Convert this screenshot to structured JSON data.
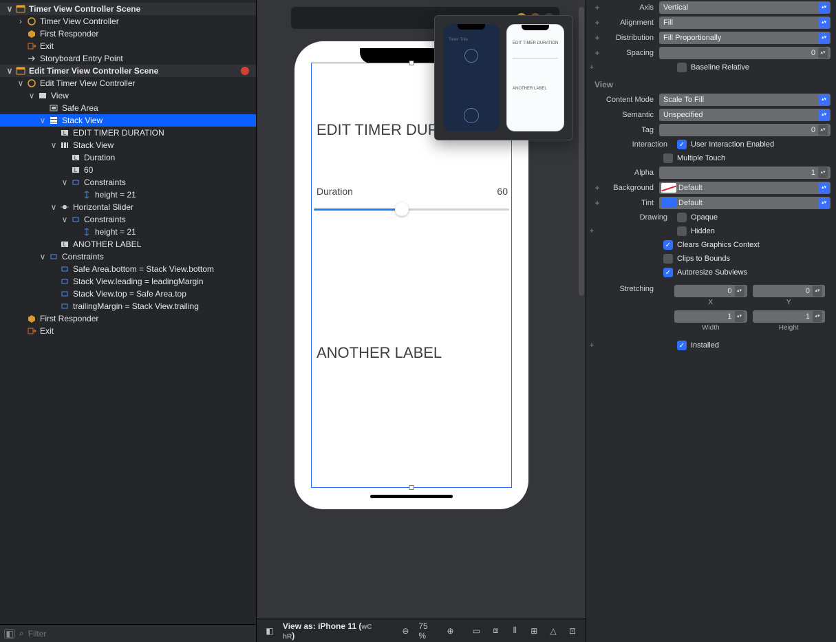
{
  "outline": {
    "scene1": "Timer View Controller Scene",
    "scene1_vc": "Timer View Controller",
    "first_responder": "First Responder",
    "exit": "Exit",
    "sb_entry": "Storyboard Entry Point",
    "scene2": "Edit Timer View Controller Scene",
    "scene2_vc": "Edit Timer View Controller",
    "view": "View",
    "safe_area": "Safe Area",
    "stack_view": "Stack View",
    "edit_timer_label": "EDIT TIMER DURATION",
    "stack_view_inner": "Stack View",
    "duration": "Duration",
    "sixty": "60",
    "constraints": "Constraints",
    "height21_a": "height = 21",
    "h_slider": "Horizontal Slider",
    "height21_b": "height = 21",
    "another_label": "ANOTHER LABEL",
    "c1": "Safe Area.bottom = Stack View.bottom",
    "c2": "Stack View.leading = leadingMargin",
    "c3": "Stack View.top = Safe Area.top",
    "c4": "trailingMargin = Stack View.trailing",
    "filter_placeholder": "Filter"
  },
  "canvas": {
    "edit_title": "EDIT TIMER DURATION",
    "duration_label": "Duration",
    "duration_value": "60",
    "another": "ANOTHER LABEL"
  },
  "minimap": {
    "a_title": "Timer Title",
    "b_title": "EDIT TIMER DURATION",
    "b_another": "ANOTHER LABEL"
  },
  "devicebar": {
    "view_as_prefix": "View as: iPhone 11 (",
    "wc": "wC",
    "hr": "hR",
    "view_as_suffix": ")",
    "zoom": "75 %"
  },
  "inspector": {
    "axis_label": "Axis",
    "axis_value": "Vertical",
    "alignment_label": "Alignment",
    "alignment_value": "Fill",
    "distribution_label": "Distribution",
    "distribution_value": "Fill Proportionally",
    "spacing_label": "Spacing",
    "spacing_value": "0",
    "baseline_relative": "Baseline Relative",
    "section_view": "View",
    "content_mode_label": "Content Mode",
    "content_mode_value": "Scale To Fill",
    "semantic_label": "Semantic",
    "semantic_value": "Unspecified",
    "tag_label": "Tag",
    "tag_value": "0",
    "interaction_label": "Interaction",
    "user_interaction": "User Interaction Enabled",
    "multiple_touch": "Multiple Touch",
    "alpha_label": "Alpha",
    "alpha_value": "1",
    "background_label": "Background",
    "background_value": "Default",
    "tint_label": "Tint",
    "tint_value": "Default",
    "drawing_label": "Drawing",
    "opaque": "Opaque",
    "hidden": "Hidden",
    "clears_gc": "Clears Graphics Context",
    "clips": "Clips to Bounds",
    "autoresize": "Autoresize Subviews",
    "stretching_label": "Stretching",
    "stretch_x": "0",
    "stretch_y": "0",
    "stretch_w": "1",
    "stretch_h": "1",
    "sub_x": "X",
    "sub_y": "Y",
    "sub_w": "Width",
    "sub_h": "Height",
    "installed": "Installed"
  }
}
